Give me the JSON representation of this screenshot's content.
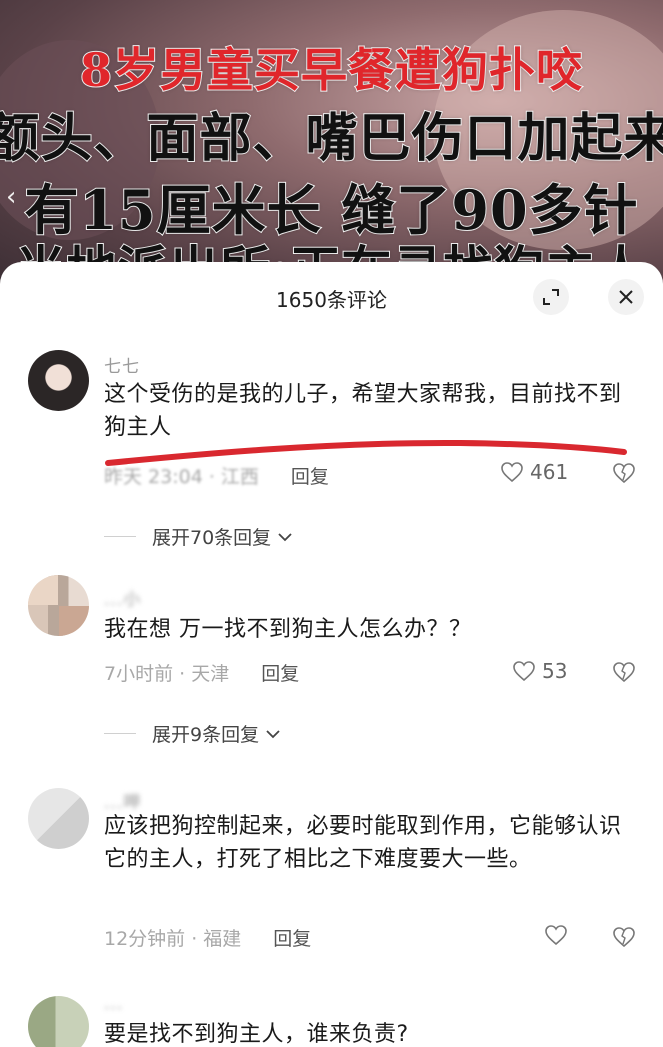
{
  "video": {
    "headline_lines": [
      "8岁男童买早餐遭狗扑咬",
      "额头、面部、嘴巴伤口加起来",
      "有15厘米长  缝了90多针",
      "当地派出所:正在寻找狗主人"
    ]
  },
  "comments_panel": {
    "title": "1650条评论",
    "expand_icon": "expand-icon",
    "close_icon": "close-icon"
  },
  "comments": [
    {
      "username": "七七",
      "text": "这个受伤的是我的儿子，希望大家帮我，目前找不到狗主人",
      "time": "昨天 23:04 · 江西",
      "reply_label": "回复",
      "likes": "461",
      "expand_replies": "展开70条回复"
    },
    {
      "username": "...小",
      "text": "我在想 万一找不到狗主人怎么办？？",
      "time": "7小时前 · 天津",
      "reply_label": "回复",
      "likes": "53",
      "expand_replies": "展开9条回复"
    },
    {
      "username": "...呷",
      "text": "应该把狗控制起来，必要时能取到作用，它能够认识它的主人，打死了相比之下难度要大一些。",
      "time": "12分钟前 · 福建",
      "reply_label": "回复",
      "likes": ""
    },
    {
      "username": "...",
      "text": "要是找不到狗主人，谁来负责?",
      "time": "",
      "reply_label": ""
    }
  ],
  "colors": {
    "headline_red": "#e0262b",
    "underline_red": "#d9282f",
    "meta_gray": "#a8a8a8"
  }
}
